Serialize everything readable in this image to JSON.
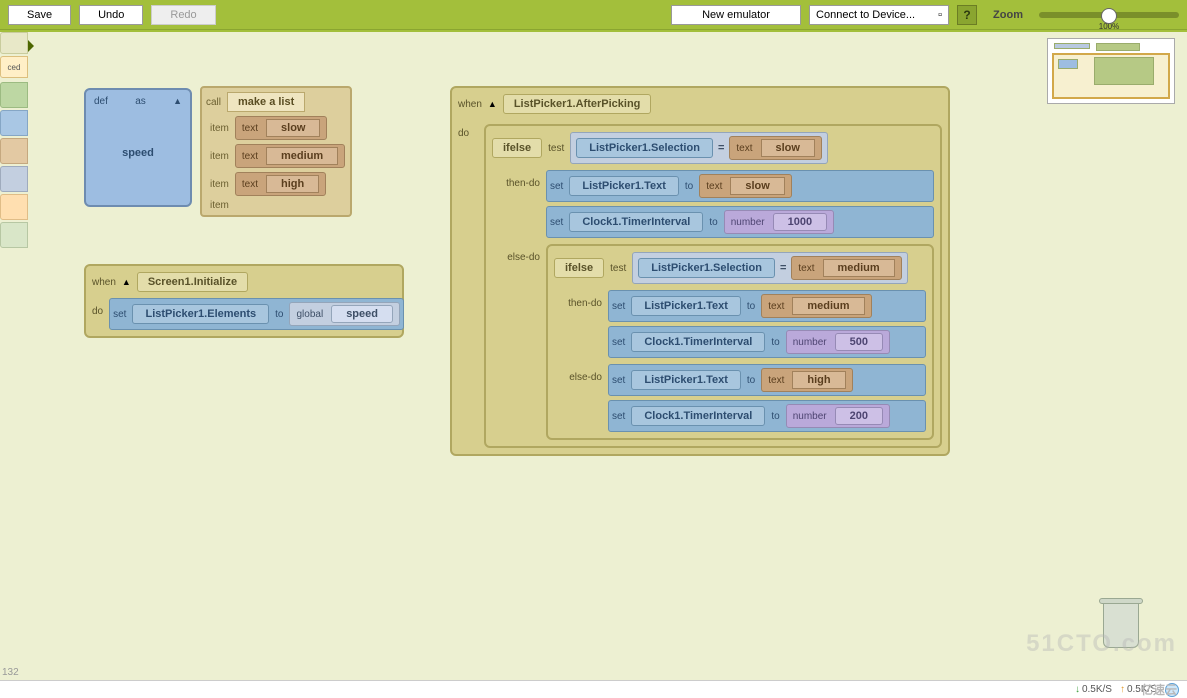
{
  "toolbar": {
    "save": "Save",
    "undo": "Undo",
    "redo": "Redo",
    "new_emulator": "New emulator",
    "connect": "Connect to Device...",
    "help": "?",
    "zoom": "Zoom",
    "zoom_pct": "100%"
  },
  "palette": {
    "ced": "ced"
  },
  "def_block": {
    "def": "def",
    "as": "as",
    "name": "speed"
  },
  "make_list": {
    "call": "call",
    "title": "make a list",
    "item": "item",
    "text": "text",
    "vals": [
      "slow",
      "medium",
      "high"
    ]
  },
  "init_block": {
    "when": "when",
    "title": "Screen1.Initialize",
    "do": "do",
    "set": "set",
    "target": "ListPicker1.Elements",
    "to": "to",
    "global": "global",
    "var": "speed"
  },
  "after_pick": {
    "when": "when",
    "title": "ListPicker1.AfterPicking",
    "do": "do",
    "ifelse": "ifelse",
    "test": "test",
    "selection": "ListPicker1.Selection",
    "eq": "=",
    "text_kw": "text",
    "then": "then-do",
    "else": "else-do",
    "set": "set",
    "to": "to",
    "lp_text": "ListPicker1.Text",
    "clock": "Clock1.TimerInterval",
    "number": "number",
    "branch1": {
      "cmp": "slow",
      "text_val": "slow",
      "num": "1000"
    },
    "branch2": {
      "cmp": "medium",
      "text_val": "medium",
      "num": "500"
    },
    "branch3": {
      "text_val": "high",
      "num": "200"
    }
  },
  "footer": {
    "down": "0.5K/S",
    "up": "0.5K/S"
  },
  "stats": "132"
}
